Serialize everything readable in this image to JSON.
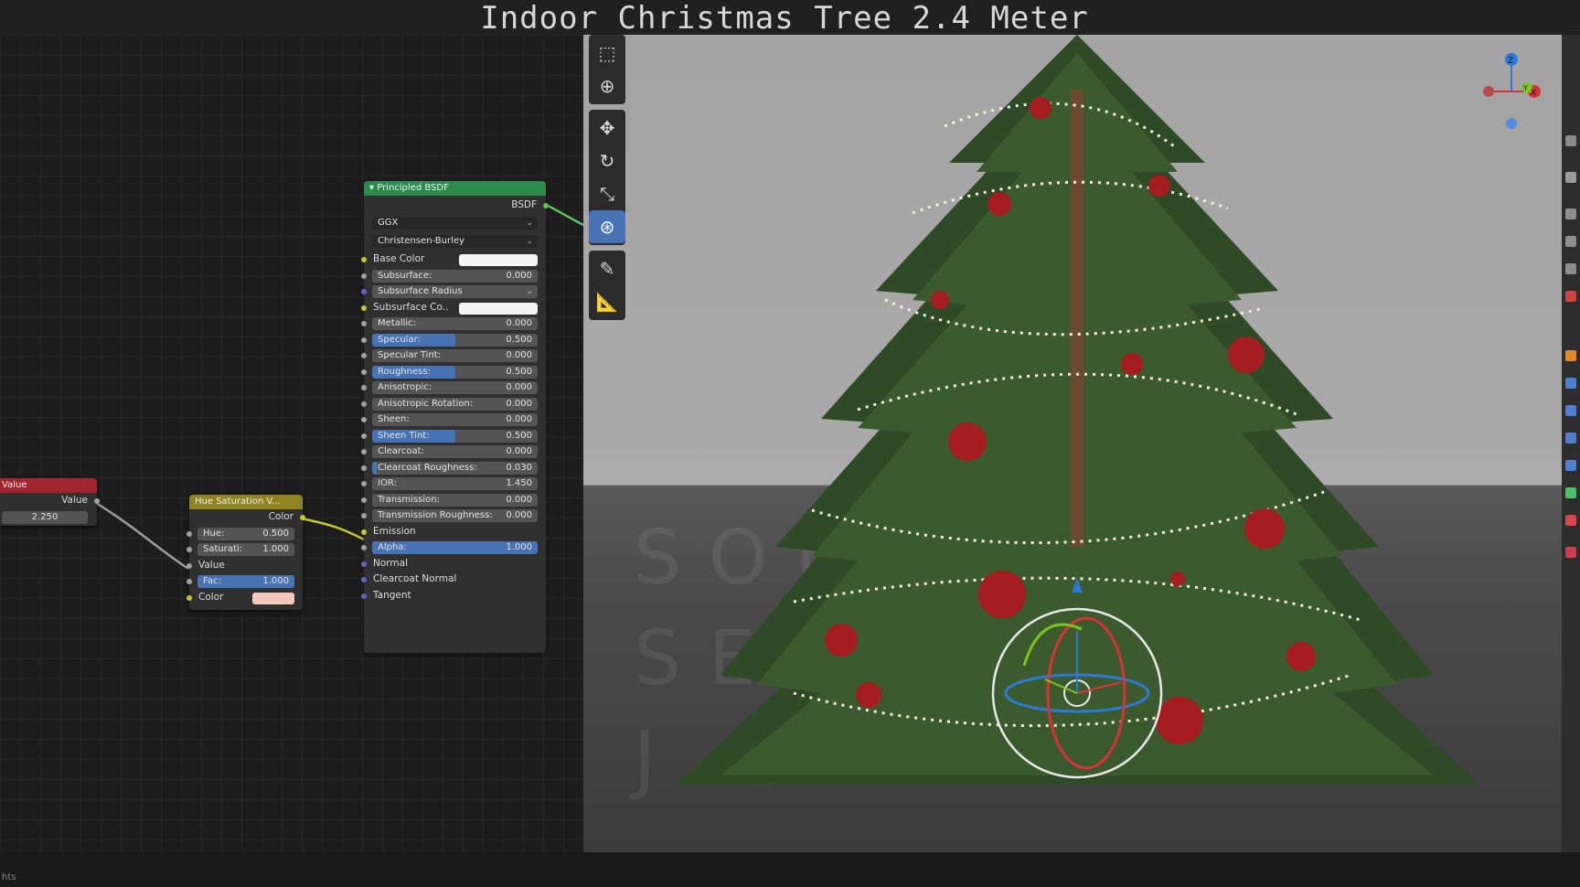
{
  "title": "Indoor Christmas Tree 2.4 Meter",
  "colors": {
    "value_header": "#a5252f",
    "hue_header": "#8f8420",
    "bsdf_header": "#2b8a4c",
    "accent_blue": "#4772b3",
    "socket_green": "#5ec35e",
    "socket_yellow": "#c7c729",
    "socket_grey": "#a1a1a1",
    "socket_blue": "#6363c7"
  },
  "value_node": {
    "title": "Value",
    "output": "Value",
    "value": "2.250"
  },
  "hue_node": {
    "title": "Hue Saturation V...",
    "output": "Color",
    "hue_label": "Hue:",
    "hue_value": "0.500",
    "saturation_label": "Saturati:",
    "saturation_value": "1.000",
    "value_label": "Value",
    "fac_label": "Fac:",
    "fac_value": "1.000",
    "fac_fraction": 1.0,
    "color_label": "Color",
    "color_swatch": "#f2c8bc"
  },
  "bsdf_node": {
    "title": "Principled BSDF",
    "output": "BSDF",
    "distribution": "GGX",
    "subsurface_method": "Christensen-Burley",
    "base_color_label": "Base Color",
    "base_color_swatch": "#f4f4f4",
    "subsurface_co_label": "Subsurface Co..",
    "subsurface_co_swatch": "#f4f4f4",
    "subsurface_radius_label": "Subsurface Radius",
    "emission_label": "Emission",
    "normal_label": "Normal",
    "clearcoat_normal_label": "Clearcoat Normal",
    "tangent_label": "Tangent",
    "params": [
      {
        "label": "Subsurface:",
        "value": "0.000",
        "fraction": 0
      },
      {
        "label": "Metallic:",
        "value": "0.000",
        "fraction": 0
      },
      {
        "label": "Specular:",
        "value": "0.500",
        "fraction": 0.5
      },
      {
        "label": "Specular Tint:",
        "value": "0.000",
        "fraction": 0
      },
      {
        "label": "Roughness:",
        "value": "0.500",
        "fraction": 0.5
      },
      {
        "label": "Anisotropic:",
        "value": "0.000",
        "fraction": 0
      },
      {
        "label": "Anisotropic Rotation:",
        "value": "0.000",
        "fraction": 0
      },
      {
        "label": "Sheen:",
        "value": "0.000",
        "fraction": 0
      },
      {
        "label": "Sheen Tint:",
        "value": "0.500",
        "fraction": 0.5
      },
      {
        "label": "Clearcoat:",
        "value": "0.000",
        "fraction": 0
      },
      {
        "label": "Clearcoat Roughness:",
        "value": "0.030",
        "fraction": 0.03
      },
      {
        "label": "IOR:",
        "value": "1.450",
        "fraction": 0
      },
      {
        "label": "Transmission:",
        "value": "0.000",
        "fraction": 0
      },
      {
        "label": "Transmission Roughness:",
        "value": "0.000",
        "fraction": 0
      },
      {
        "label": "Alpha:",
        "value": "1.000",
        "fraction": 1.0
      }
    ]
  },
  "toolbar": {
    "tools": [
      "select-box-icon",
      "cursor-icon",
      "move-icon",
      "rotate-icon",
      "scale-icon",
      "transform-icon",
      "annotate-icon",
      "measure-icon"
    ],
    "active_tool": "transform-icon"
  },
  "axis_gizmo": {
    "x": "X",
    "y": "Y",
    "z": "Z"
  },
  "watermark": [
    "SOF",
    "SER",
    "J C"
  ],
  "status": {
    "text": "hts"
  }
}
